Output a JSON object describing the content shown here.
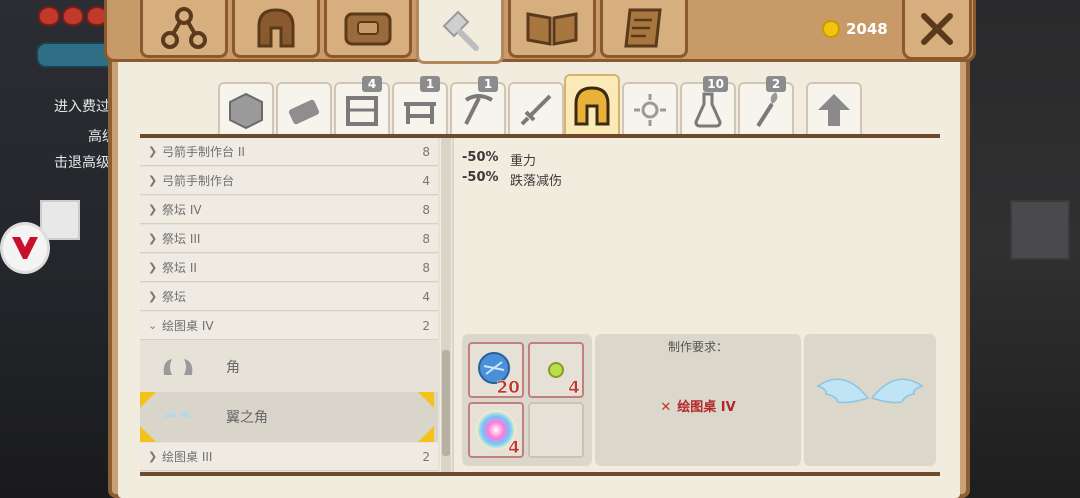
{
  "hud": {
    "left_lines": [
      "进入费过",
      "高级",
      "击退高级"
    ]
  },
  "currency": {
    "amount": "2048",
    "icon": "gold-coin-icon"
  },
  "top_tabs": [
    {
      "icon": "tech-tree-icon"
    },
    {
      "icon": "helmet-icon"
    },
    {
      "icon": "backpack-icon"
    },
    {
      "icon": "crafting-hammer-icon",
      "active": true
    },
    {
      "icon": "book-icon"
    },
    {
      "icon": "scroll-icon"
    }
  ],
  "close": {
    "icon": "close-icon"
  },
  "category_tabs": [
    {
      "icon": "block-icon",
      "badge": ""
    },
    {
      "icon": "materials-icon",
      "badge": ""
    },
    {
      "icon": "furniture-icon",
      "badge": "4"
    },
    {
      "icon": "table-icon",
      "badge": "1"
    },
    {
      "icon": "pickaxe-icon",
      "badge": "1"
    },
    {
      "icon": "sword-icon",
      "badge": ""
    },
    {
      "icon": "helmet-icon",
      "badge": "",
      "active": true
    },
    {
      "icon": "sparkle-icon",
      "badge": ""
    },
    {
      "icon": "potion-icon",
      "badge": "10"
    },
    {
      "icon": "torch-icon",
      "badge": "2"
    },
    {
      "icon": "upgrade-arrow-icon",
      "badge": ""
    }
  ],
  "list": {
    "rows": [
      {
        "name": "弓箭手制作台 II",
        "count": "8"
      },
      {
        "name": "弓箭手制作台",
        "count": "4"
      },
      {
        "name": "祭坛 IV",
        "count": "8"
      },
      {
        "name": "祭坛 III",
        "count": "8"
      },
      {
        "name": "祭坛 II",
        "count": "8"
      },
      {
        "name": "祭坛",
        "count": "4"
      },
      {
        "name": "绘图桌 IV",
        "count": "2",
        "expanded": true
      }
    ],
    "subitems": [
      {
        "name": "角",
        "icon": "horns-icon"
      },
      {
        "name": "翼之角",
        "icon": "winged-horns-icon",
        "selected": true
      }
    ],
    "last_row": {
      "name": "绘图桌 III",
      "count": "2"
    }
  },
  "stats": [
    {
      "pct": "-50%",
      "label": "重力"
    },
    {
      "pct": "-50%",
      "label": "跌落减伤"
    }
  ],
  "ingredients": [
    {
      "icon": "blue-crystal-icon",
      "qty": "20"
    },
    {
      "icon": "green-gem-icon",
      "qty": "4"
    },
    {
      "icon": "rainbow-orb-icon",
      "qty": "4"
    },
    {
      "icon": "",
      "qty": ""
    }
  ],
  "requirements": {
    "title": "制作要求：",
    "item": "绘图桌 IV",
    "status_icon": "cross-icon"
  },
  "result": {
    "icon": "wings-icon"
  }
}
